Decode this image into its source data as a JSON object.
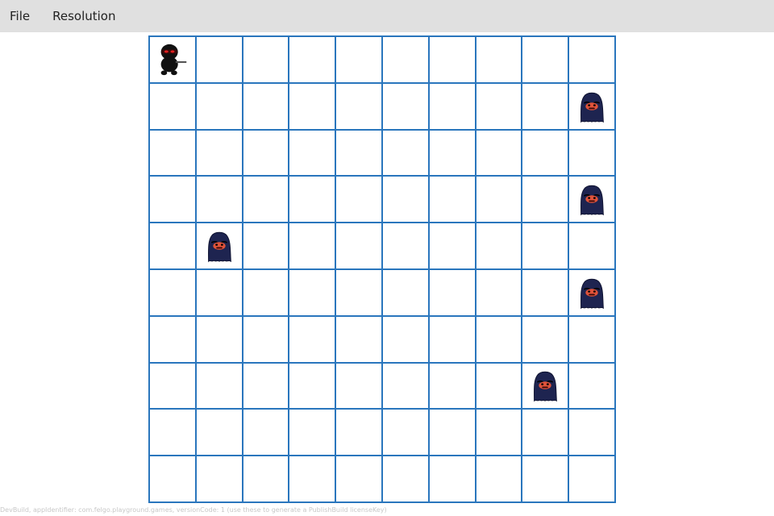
{
  "menu": {
    "items": [
      "File",
      "Resolution"
    ]
  },
  "board": {
    "rows": 10,
    "cols": 10,
    "grid_color": "#2a76bd",
    "cell_color": "#ffffff",
    "player": {
      "row": 0,
      "col": 0,
      "icon": "ninja-icon"
    },
    "enemies": [
      {
        "row": 1,
        "col": 9,
        "icon": "ghost-icon"
      },
      {
        "row": 3,
        "col": 9,
        "icon": "ghost-icon"
      },
      {
        "row": 4,
        "col": 1,
        "icon": "ghost-icon"
      },
      {
        "row": 5,
        "col": 9,
        "icon": "ghost-icon"
      },
      {
        "row": 7,
        "col": 8,
        "icon": "ghost-icon"
      }
    ]
  },
  "footer": {
    "note": "DevBuild, appIdentifier: com.felgo.playground.games, versionCode: 1 (use these to generate a PublishBuild licenseKey)"
  },
  "colors": {
    "menubar_bg": "#e0e0e0",
    "ghost_body": "#1e2450",
    "ghost_face": "#e0533a",
    "ninja_body": "#111111",
    "ninja_eyes": "#e02020"
  }
}
